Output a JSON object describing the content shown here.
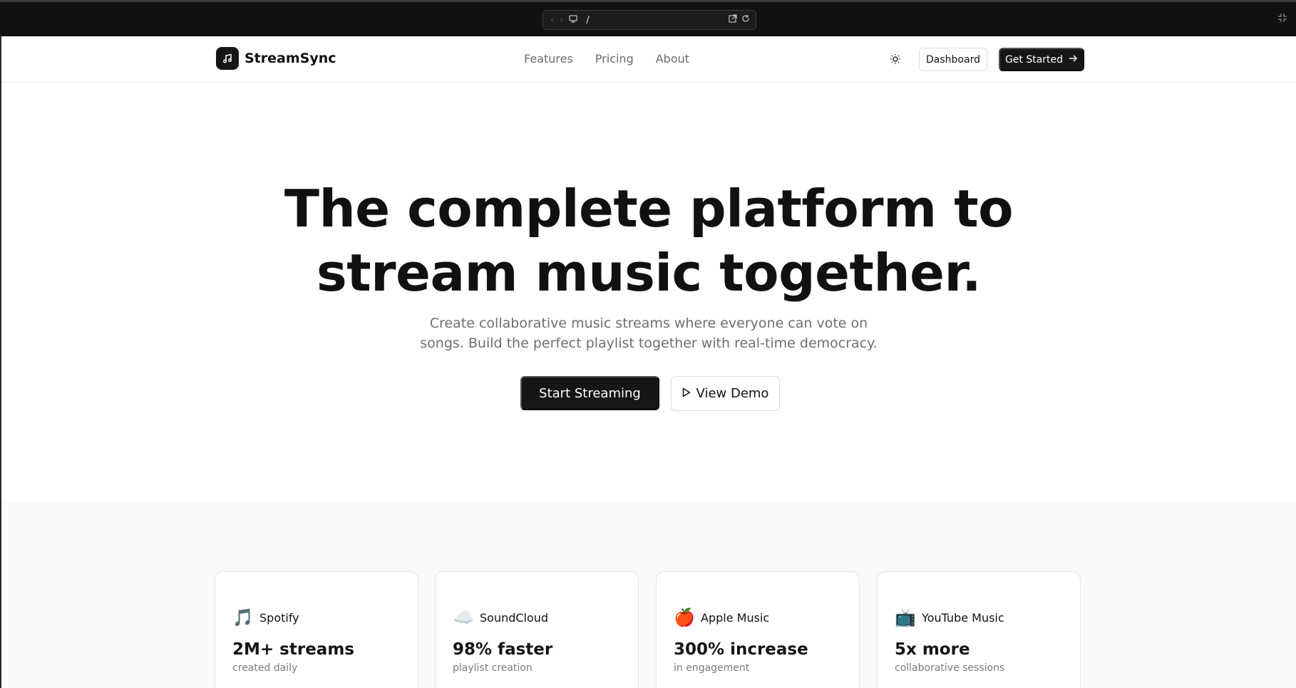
{
  "browser": {
    "path": "/",
    "back_icon": "chevron-left-icon",
    "forward_icon": "chevron-right-icon"
  },
  "header": {
    "brand_name": "StreamSync",
    "nav": [
      "Features",
      "Pricing",
      "About"
    ],
    "dashboard_label": "Dashboard",
    "get_started_label": "Get Started"
  },
  "hero": {
    "title_line1": "The complete platform to",
    "title_line2": "stream music together.",
    "subtitle_line1": "Create collaborative music streams where everyone can vote on",
    "subtitle_line2": "songs. Build the perfect playlist together with real-time democracy.",
    "start_label": "Start Streaming",
    "demo_label": "View Demo"
  },
  "stats": [
    {
      "emoji": "🎵",
      "name": "Spotify",
      "value": "2M+ streams",
      "caption": "created daily"
    },
    {
      "emoji": "☁️",
      "name": "SoundCloud",
      "value": "98% faster",
      "caption": "playlist creation"
    },
    {
      "emoji": "🍎",
      "name": "Apple Music",
      "value": "300% increase",
      "caption": "in engagement"
    },
    {
      "emoji": "📺",
      "name": "YouTube Music",
      "value": "5x more",
      "caption": "collaborative sessions"
    }
  ],
  "colors": {
    "primary": "#161616",
    "muted_text": "#6e6e6e",
    "stats_bg": "#fafafa"
  }
}
